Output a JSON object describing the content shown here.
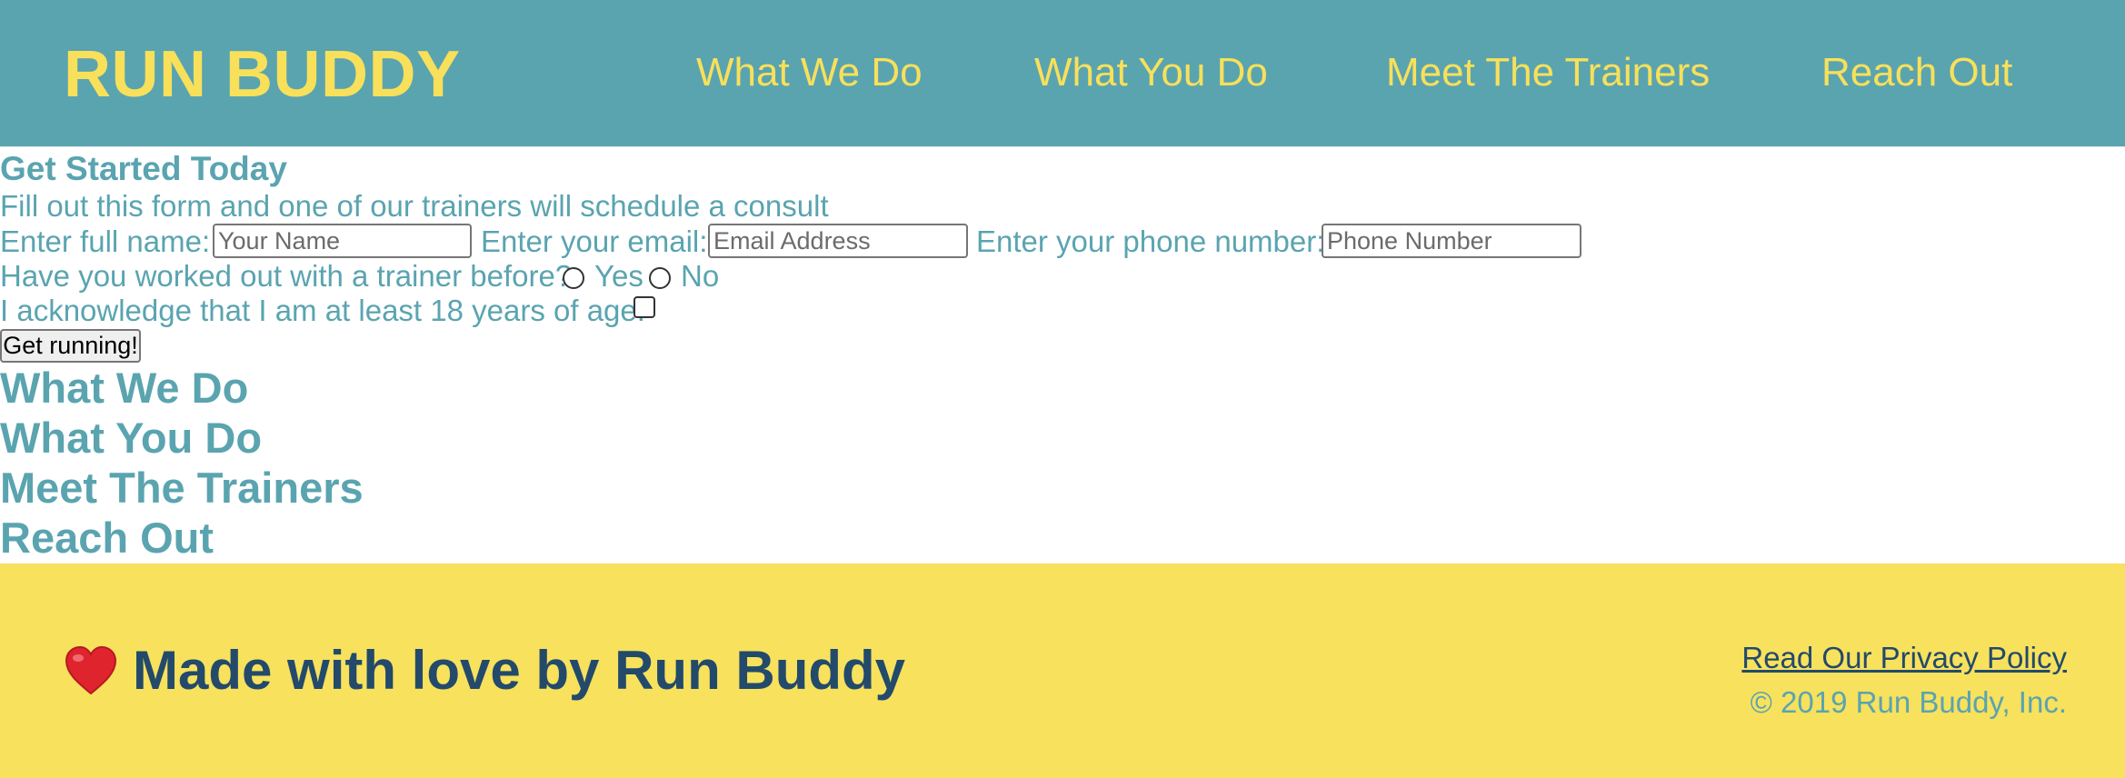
{
  "header": {
    "brand": "RUN BUDDY",
    "nav": [
      "What We Do",
      "What You Do",
      "Meet The Trainers",
      "Reach Out"
    ]
  },
  "form": {
    "title": "Get Started Today",
    "subtitle": "Fill out this form and one of our trainers will schedule a consult",
    "name_label": "Enter full name:",
    "name_placeholder": "Your Name",
    "email_label": "Enter your email:",
    "email_placeholder": "Email Address",
    "phone_label": "Enter your phone number:",
    "phone_placeholder": "Phone Number",
    "trainer_question": "Have you worked out with a trainer before?",
    "yes_label": "Yes",
    "no_label": "No",
    "age_ack": "I acknowledge that I am at least 18 years of age.",
    "submit_label": "Get running!"
  },
  "sections": [
    "What We Do",
    "What You Do",
    "Meet The Trainers",
    "Reach Out"
  ],
  "footer": {
    "made_with": "Made with love by Run Buddy",
    "privacy_link": "Read Our Privacy Policy",
    "copyright": "© 2019 Run Buddy, Inc."
  },
  "colors": {
    "header_bg": "#5aa4b0",
    "brand_yellow": "#f8e05a",
    "footer_bg": "#f7e15d",
    "footer_navy": "#234a6b"
  }
}
